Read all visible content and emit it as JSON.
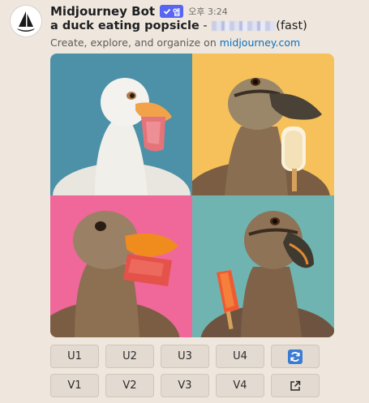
{
  "message": {
    "bot_name": "Midjourney Bot",
    "app_badge": "앱",
    "timestamp": "오후 3:24",
    "prompt_bold": "a duck eating popsicle",
    "prompt_sep": " - ",
    "prompt_suffix": "(fast)",
    "subtitle_text": "Create, explore, and organize on ",
    "subtitle_link": "midjourney.com"
  },
  "image_grid": {
    "tiles": [
      {
        "name": "white duck with pink popsicle",
        "background": "#4c91a7"
      },
      {
        "name": "mallard duck with vanilla popsicle",
        "background": "#f6c15a"
      },
      {
        "name": "brown duck with red popsicle",
        "background": "#f0679a"
      },
      {
        "name": "duck with orange popsicle",
        "background": "#6fb4b1"
      }
    ]
  },
  "buttons": {
    "upscale": [
      "U1",
      "U2",
      "U3",
      "U4"
    ],
    "variation": [
      "V1",
      "V2",
      "V3",
      "V4"
    ],
    "reroll_icon": "refresh-icon",
    "open_icon": "external-link-icon"
  },
  "colors": {
    "background": "#efe7dd",
    "badge": "#5865f2",
    "link": "#0a6fbf",
    "reroll": "#3a7bd5"
  }
}
